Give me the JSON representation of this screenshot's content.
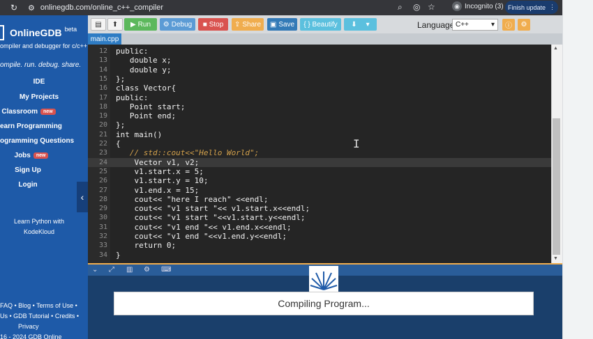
{
  "browser": {
    "reload_icon": "reload-icon",
    "url": "onlinegdb.com/online_c++_compiler",
    "profile_label": "Incognito (3)",
    "finish_update": "Finish update"
  },
  "sidebar": {
    "logo_name": "OnlineGDB",
    "logo_beta": "beta",
    "tagline": "ompiler and debugger for c/c++",
    "motto": "ompile. run. debug. share.",
    "nav": [
      {
        "label": "IDE"
      },
      {
        "label": "My Projects"
      },
      {
        "label": "Classroom",
        "badge": "new"
      },
      {
        "label": "earn Programming"
      },
      {
        "label": "ogramming Questions"
      },
      {
        "label": "Jobs",
        "badge": "new"
      },
      {
        "label": "Sign Up"
      },
      {
        "label": "Login"
      }
    ],
    "ad_line1": "Learn Python with",
    "ad_line2": "KodeKloud",
    "footer_line1": "FAQ • Blog • Terms of Use •",
    "footer_line2": "Us • GDB Tutorial • Credits •",
    "footer_line3": "Privacy",
    "footer_line4": "16 - 2024 GDB Online"
  },
  "toolbar": {
    "run": "Run",
    "debug": "Debug",
    "stop": "Stop",
    "share": "Share",
    "save": "Save",
    "beautify": "{ } Beautify",
    "language_label": "Language",
    "language_value": "C++"
  },
  "tabs": [
    {
      "label": "main.cpp"
    }
  ],
  "code_lines": [
    {
      "n": "12",
      "text": "public:"
    },
    {
      "n": "13",
      "text": "   double x;"
    },
    {
      "n": "14",
      "text": "   double y;"
    },
    {
      "n": "15",
      "text": "};"
    },
    {
      "n": "16",
      "text": "class Vector{"
    },
    {
      "n": "17",
      "text": "public:"
    },
    {
      "n": "18",
      "text": "   Point start;"
    },
    {
      "n": "19",
      "text": "   Point end;"
    },
    {
      "n": "20",
      "text": "};"
    },
    {
      "n": "21",
      "text": "int main()"
    },
    {
      "n": "22",
      "text": "{"
    },
    {
      "n": "23",
      "text": "   // std::cout<<\"Hello World\";"
    },
    {
      "n": "24",
      "text": "    Vector v1, v2;"
    },
    {
      "n": "25",
      "text": "    v1.start.x = 5;"
    },
    {
      "n": "26",
      "text": "    v1.start.y = 10;"
    },
    {
      "n": "27",
      "text": "    v1.end.x = 15;"
    },
    {
      "n": "28",
      "text": "    cout<< \"here I reach\" <<endl;"
    },
    {
      "n": "29",
      "text": "    cout<< \"v1 start \"<< v1.start.x<<endl;"
    },
    {
      "n": "30",
      "text": "    cout<< \"v1 start \"<<v1.start.y<<endl;"
    },
    {
      "n": "31",
      "text": "    cout<< \"v1 end \"<< v1.end.x<<endl;"
    },
    {
      "n": "32",
      "text": "    cout<< \"v1 end \"<<v1.end.y<<endl;"
    },
    {
      "n": "33",
      "text": "    return 0;"
    },
    {
      "n": "34",
      "text": "}"
    }
  ],
  "console": {
    "status": "Compiling Program..."
  },
  "colors": {
    "sidebar": "#1e5aa8",
    "run": "#5cb85c",
    "debug": "#5b9bd5",
    "stop": "#d9534f",
    "share": "#f0ad4e",
    "save": "#337ab7",
    "beautify": "#5bc0de",
    "comment": "#d4a24c",
    "string": "#f2f2f2",
    "number": "#e5a05d"
  }
}
